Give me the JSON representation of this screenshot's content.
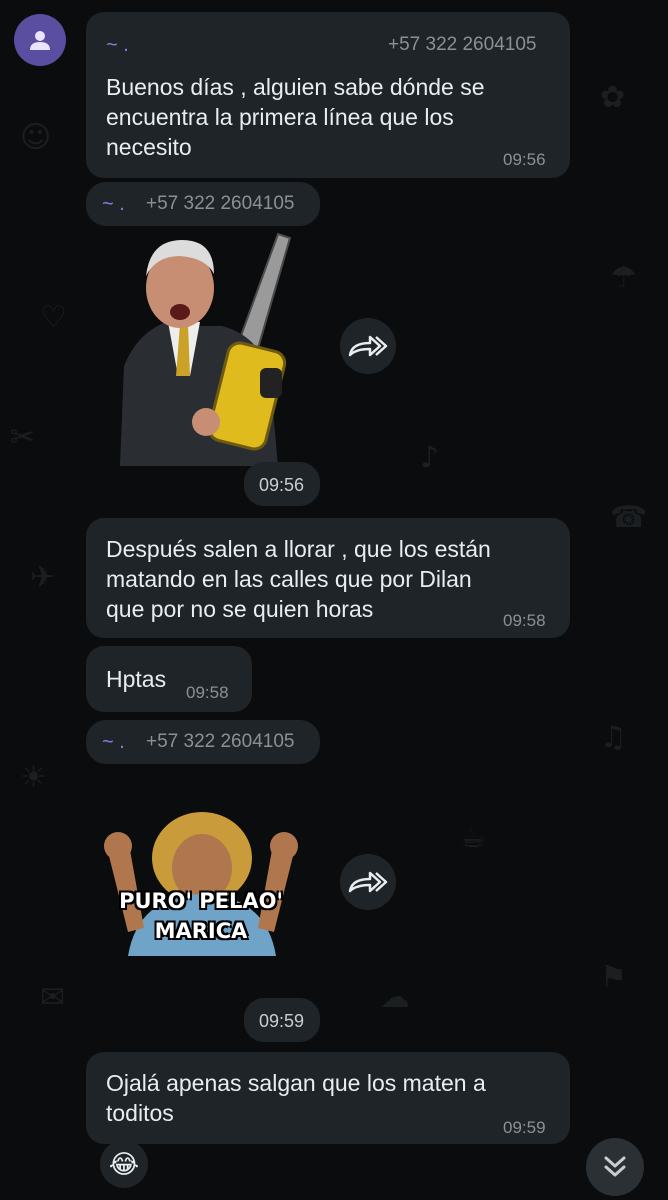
{
  "messages": [
    {
      "sender_name": "~ .",
      "sender_phone": "+57 322 2604105",
      "lines": [
        "Buenos días , alguien sabe dónde se",
        "encuentra la primera línea que los",
        "necesito"
      ],
      "time": "09:56"
    },
    {
      "sender_name": "~ .",
      "sender_phone": "+57 322 2604105",
      "sticker": "man-with-chainsaw-sticker",
      "time": "09:56"
    },
    {
      "lines": [
        "Después salen a llorar , que los están",
        "matando en las calles que por Dilan",
        "que por no se quien horas"
      ],
      "time": "09:58"
    },
    {
      "text": "Hptas",
      "time": "09:58"
    },
    {
      "sender_name": "~ .",
      "sender_phone": "+57 322 2604105",
      "sticker": "puro-pelao-sticker",
      "sticker_text": [
        "PURO' PELAO'",
        "MARICA"
      ],
      "time": "09:59"
    },
    {
      "lines": [
        "Ojalá apenas salgan que los maten a",
        "toditos"
      ],
      "time": "09:59"
    }
  ],
  "icons": {
    "avatar": "person-icon",
    "forward": "forward-icon",
    "reaction": "laughing-emoji-icon",
    "scroll": "double-chevron-down-icon"
  },
  "reaction_emoji": "😂",
  "colors": {
    "background": "#0b0c0d",
    "bubble": "#1f2428",
    "sender_name": "#8c7ae6",
    "avatar": "#5a4ea0"
  }
}
